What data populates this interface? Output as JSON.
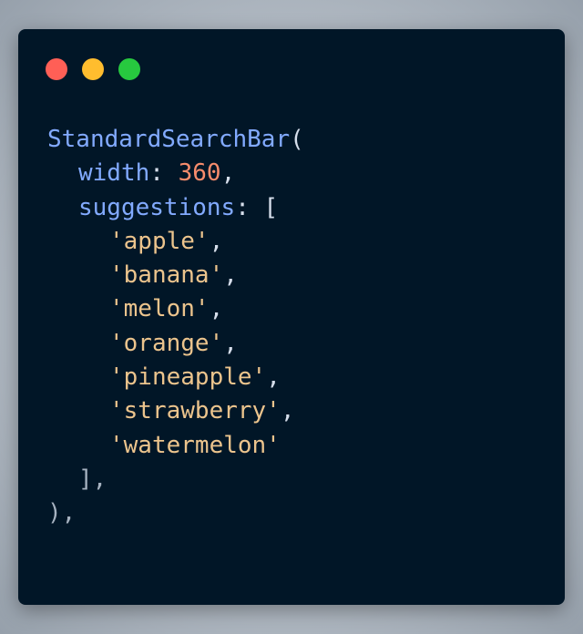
{
  "window": {
    "controls": [
      {
        "name": "close-dot",
        "color": "#ff5f56"
      },
      {
        "name": "minimize-dot",
        "color": "#ffbd2e"
      },
      {
        "name": "zoom-dot",
        "color": "#27c93f"
      }
    ]
  },
  "code": {
    "function_name": "StandardSearchBar",
    "open_paren": "(",
    "width_key": "width",
    "colon": ":",
    "width_value": "360",
    "comma": ",",
    "suggestions_key": "suggestions",
    "open_bracket": "[",
    "suggestions": [
      "'apple'",
      "'banana'",
      "'melon'",
      "'orange'",
      "'pineapple'",
      "'strawberry'",
      "'watermelon'"
    ],
    "close_bracket": "],",
    "close_paren": "),"
  }
}
